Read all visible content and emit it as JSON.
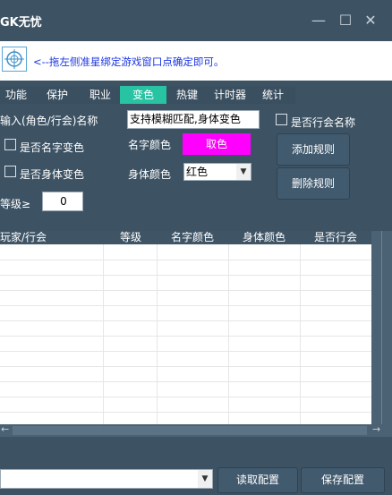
{
  "window": {
    "title": "GK无忧",
    "min": "—",
    "max": "☐",
    "close": "✕"
  },
  "banner": {
    "hint": "<--拖左侧准星绑定游戏窗口点确定即可。",
    "icon": "crosshair-icon"
  },
  "tabs": [
    {
      "label": "功能",
      "active": false
    },
    {
      "label": "保护",
      "active": false
    },
    {
      "label": "职业",
      "active": false
    },
    {
      "label": "变色",
      "active": true
    },
    {
      "label": "热键",
      "active": false
    },
    {
      "label": "计时器",
      "active": false
    },
    {
      "label": "统计",
      "active": false
    }
  ],
  "form": {
    "input_label": "输入(角色/行会)名称",
    "name_value": "支持模糊匹配,身体变色",
    "guild_name_check": "是否行会名称",
    "name_color_check": "是否名字变色",
    "name_color_label": "名字颜色",
    "pick_color_btn": "取色",
    "pick_color_bg": "#ff00ff",
    "body_color_check": "是否身体变色",
    "body_color_label": "身体颜色",
    "body_color_value": "红色",
    "level_label": "等级≥",
    "level_value": "0",
    "add_rule": "添加规则",
    "delete_rule": "删除规则"
  },
  "table": {
    "columns": [
      "玩家/行会",
      "等级",
      "名字颜色",
      "身体颜色",
      "是否行会"
    ],
    "rows": []
  },
  "footer": {
    "config_select": "",
    "read_config": "读取配置",
    "save_config": "保存配置"
  },
  "colors": {
    "accent": "#27c3a3",
    "bg": "#3d5364",
    "hint": "#1b35e0"
  }
}
